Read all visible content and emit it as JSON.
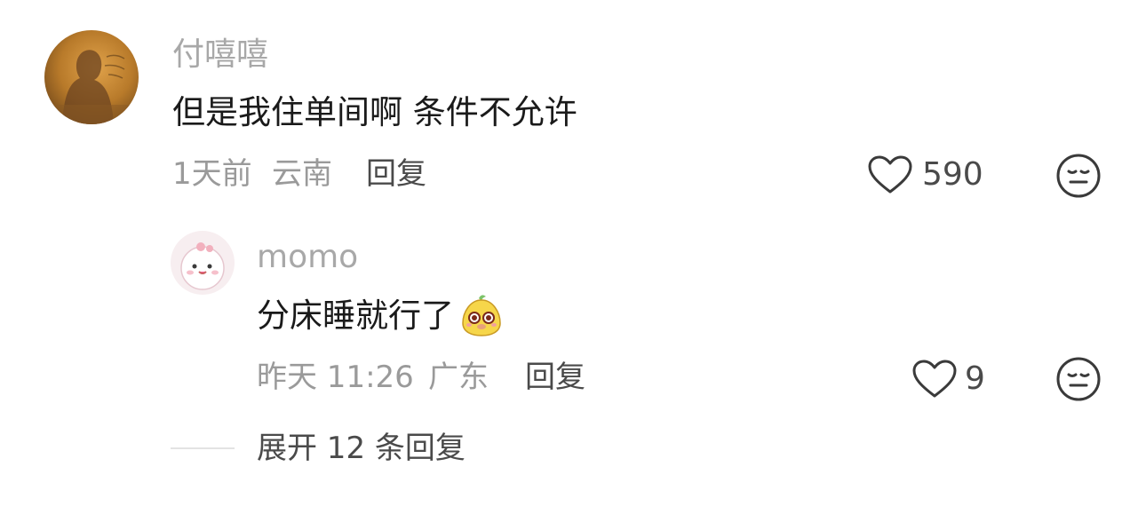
{
  "comment": {
    "username": "付嘻嘻",
    "text": "但是我住单间啊 条件不允许",
    "time": "1天前",
    "location": "云南",
    "reply_label": "回复",
    "likes": "590"
  },
  "reply": {
    "username": "momo",
    "text": "分床睡就行了",
    "time": "昨天 11:26",
    "location": "广东",
    "reply_label": "回复",
    "likes": "9"
  },
  "expand": {
    "label": "展开 12 条回复"
  },
  "icons": {
    "like": "heart-outline-icon",
    "dislike": "meh-face-icon",
    "emoji": "yellow-cartoon-emoji"
  },
  "colors": {
    "text_primary": "#1a1a1a",
    "text_secondary": "#9a9a9a",
    "action": "#4a4a4a"
  }
}
